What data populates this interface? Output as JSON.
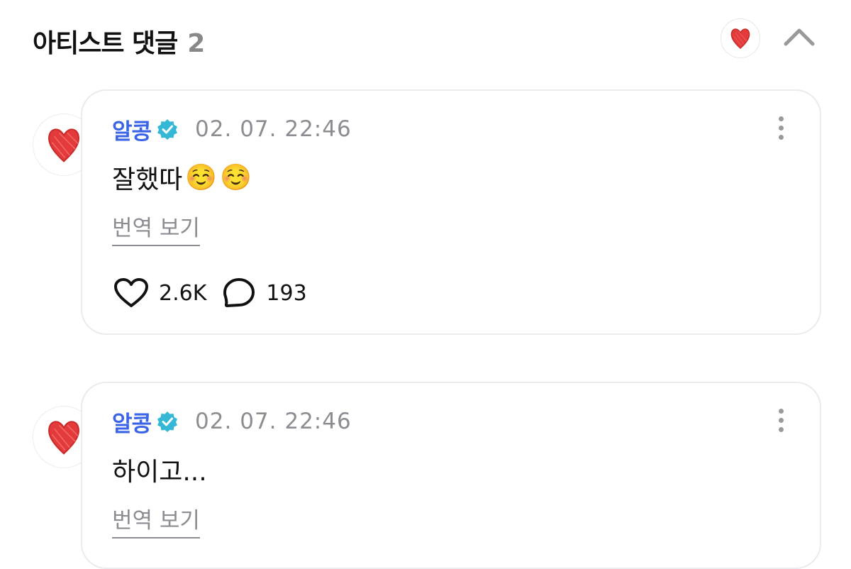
{
  "header": {
    "title": "아티스트 댓글",
    "count": "2"
  },
  "comments": [
    {
      "author": "알콩",
      "timestamp": "02. 07. 22:46",
      "text": "잘했따",
      "emojis": [
        "☺️",
        "☺️"
      ],
      "translate_label": "번역 보기",
      "likes": "2.6K",
      "replies": "193"
    },
    {
      "author": "알콩",
      "timestamp": "02. 07. 22:46",
      "text": "하이고...",
      "translate_label": "번역 보기"
    }
  ],
  "colors": {
    "author": "#3a63e6",
    "verified_badge": "#34b8d6",
    "heart": "#e33b3b",
    "muted": "#8c8c92"
  },
  "icons": [
    "heart-avatar-icon",
    "chevron-up-icon",
    "verified-badge-icon",
    "more-vertical-icon",
    "heart-outline-icon",
    "speech-bubble-icon"
  ]
}
